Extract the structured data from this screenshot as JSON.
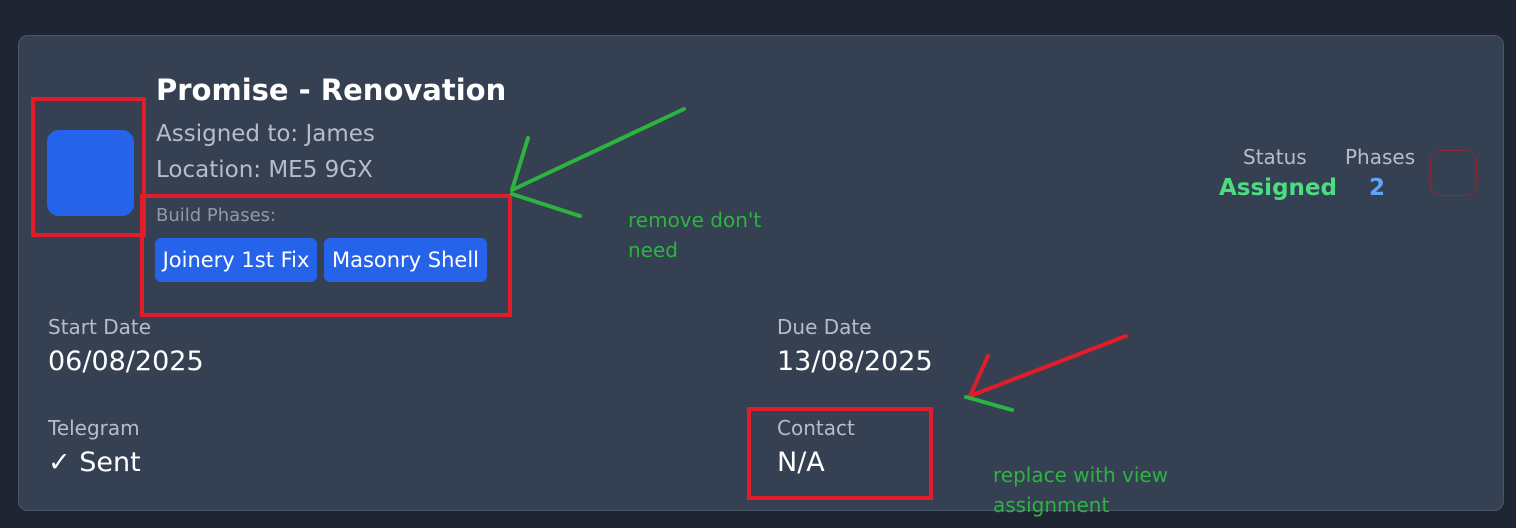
{
  "card": {
    "title": "Promise - Renovation",
    "assigned": "Assigned to: James",
    "location": "Location: ME5 9GX",
    "phases_label": "Build Phases:",
    "chips": [
      "Joinery 1st Fix",
      "Masonry Shell"
    ],
    "status_label": "Status",
    "status_value": "Assigned",
    "phases_count_label": "Phases",
    "phases_count_value": "2",
    "start_label": "Start Date",
    "start_value": "06/08/2025",
    "due_label": "Due Date",
    "due_value": "13/08/2025",
    "telegram_label": "Telegram",
    "telegram_value": "✓ Sent",
    "contact_label": "Contact",
    "contact_value": "N/A"
  },
  "annotations": {
    "note1": "remove don't need",
    "note2": "replace with view assignment"
  },
  "colors": {
    "card_bg": "#354052",
    "accent_blue": "#2563eb",
    "status_green": "#4ade80",
    "count_blue": "#60a5fa",
    "annotation_red": "#e11d2a",
    "annotation_green": "#2bb540"
  }
}
